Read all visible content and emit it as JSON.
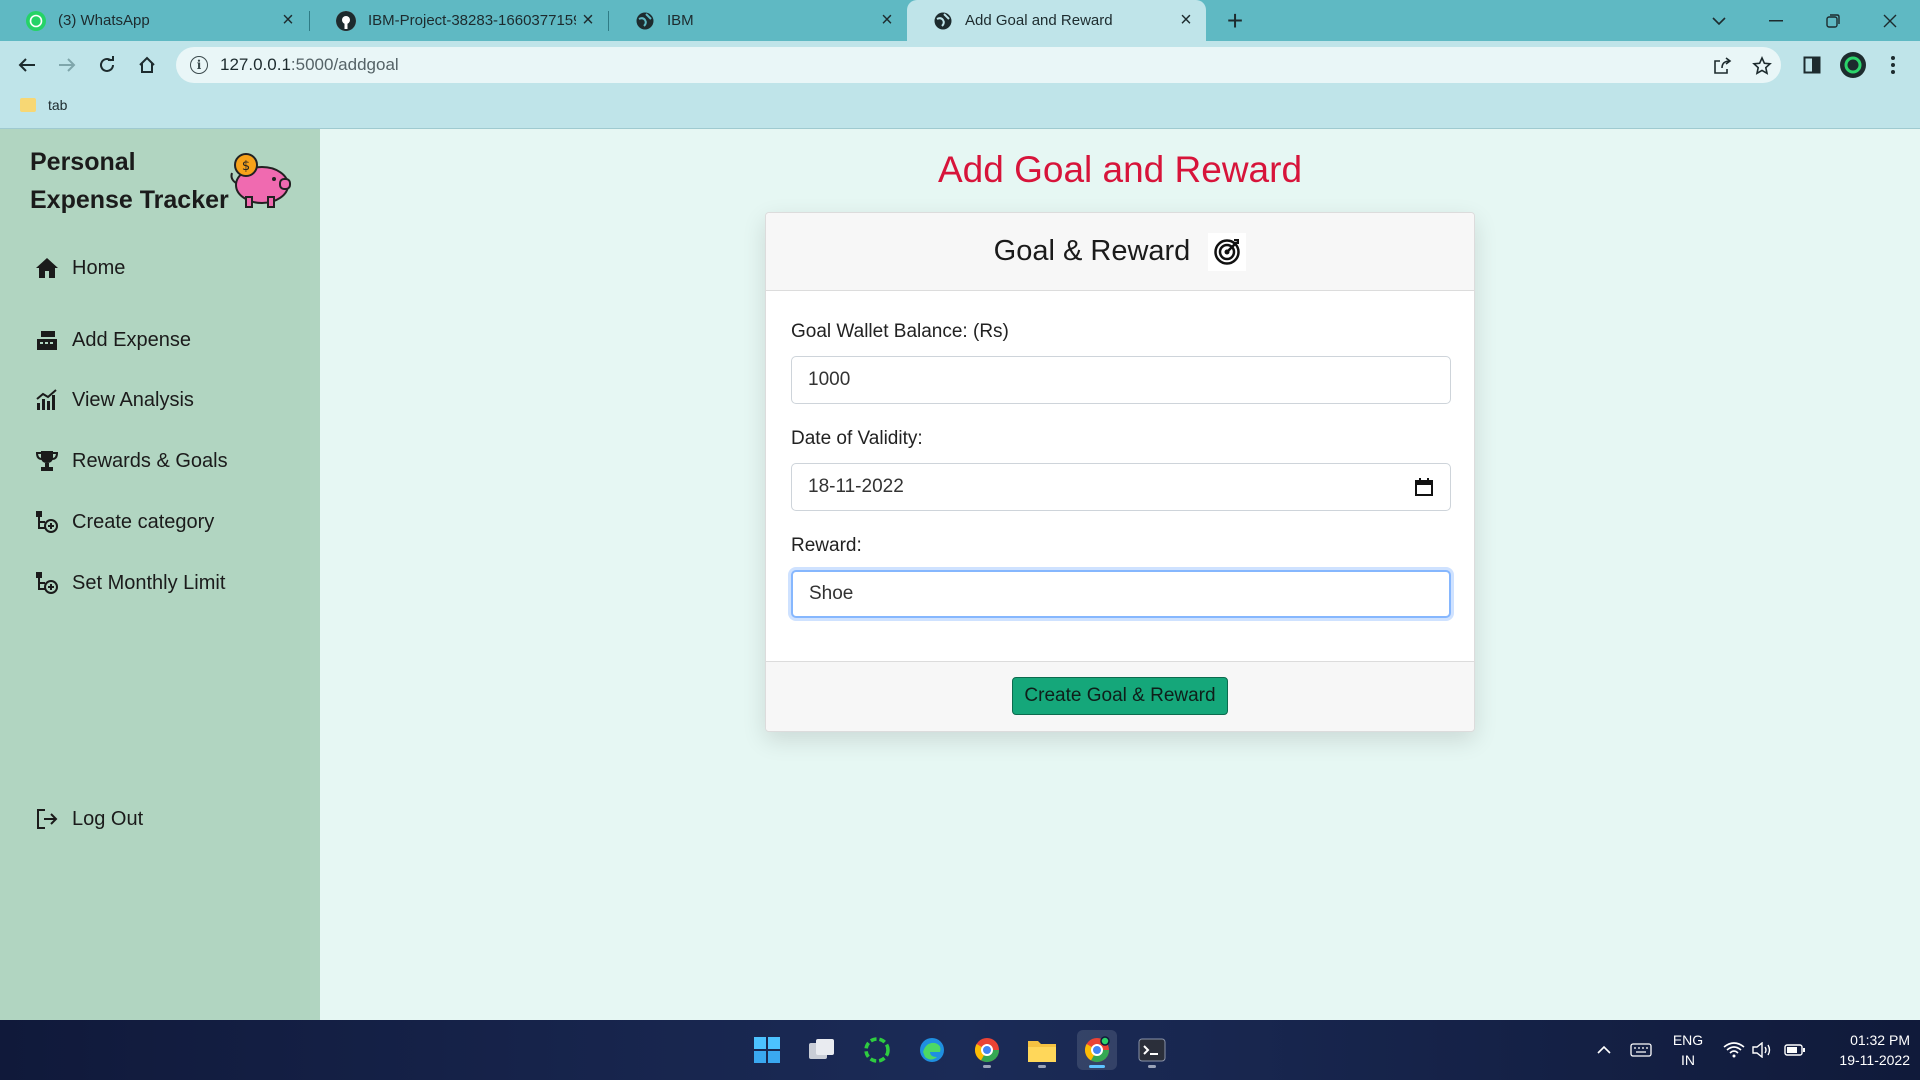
{
  "browser": {
    "tabs": [
      {
        "title": "(3) WhatsApp",
        "icon": "whatsapp-icon"
      },
      {
        "title": "IBM-Project-38283-1660377159/",
        "icon": "github-icon"
      },
      {
        "title": "IBM",
        "icon": "globe-icon"
      },
      {
        "title": "Add Goal and Reward",
        "icon": "globe-icon",
        "active": true
      }
    ],
    "url_host": "127.0.0.1",
    "url_path": ":5000/addgoal",
    "bookmarks": [
      {
        "label": "tab"
      }
    ]
  },
  "sidebar": {
    "brand_line1": "Personal",
    "brand_line2": "Expense Tracker",
    "items": [
      {
        "label": "Home",
        "icon": "home-icon"
      },
      {
        "label": "Add Expense",
        "icon": "cash-register-icon"
      },
      {
        "label": "View Analysis",
        "icon": "chart-icon"
      },
      {
        "label": "Rewards & Goals",
        "icon": "trophy-icon"
      },
      {
        "label": "Create category",
        "icon": "category-tree-icon"
      },
      {
        "label": "Set Monthly Limit",
        "icon": "category-tree-icon"
      }
    ],
    "logout": "Log Out"
  },
  "main": {
    "title": "Add Goal and Reward",
    "card": {
      "header": "Goal & Reward",
      "fields": [
        {
          "label": "Goal Wallet Balance: (Rs)",
          "value": "1000"
        },
        {
          "label": "Date of Validity:",
          "value": "18-11-2022"
        },
        {
          "label": "Reward:",
          "value": "Shoe"
        }
      ],
      "submit": "Create Goal & Reward"
    }
  },
  "taskbar": {
    "lang_line1": "ENG",
    "lang_line2": "IN",
    "time": "01:32 PM",
    "date": "19-11-2022"
  },
  "colors": {
    "title_red": "#d7143a",
    "sidebar_bg": "#b1d5c1",
    "main_bg": "#e6f7f3",
    "button_green": "#15a77a",
    "chrome_tab": "#5fb9c3"
  }
}
